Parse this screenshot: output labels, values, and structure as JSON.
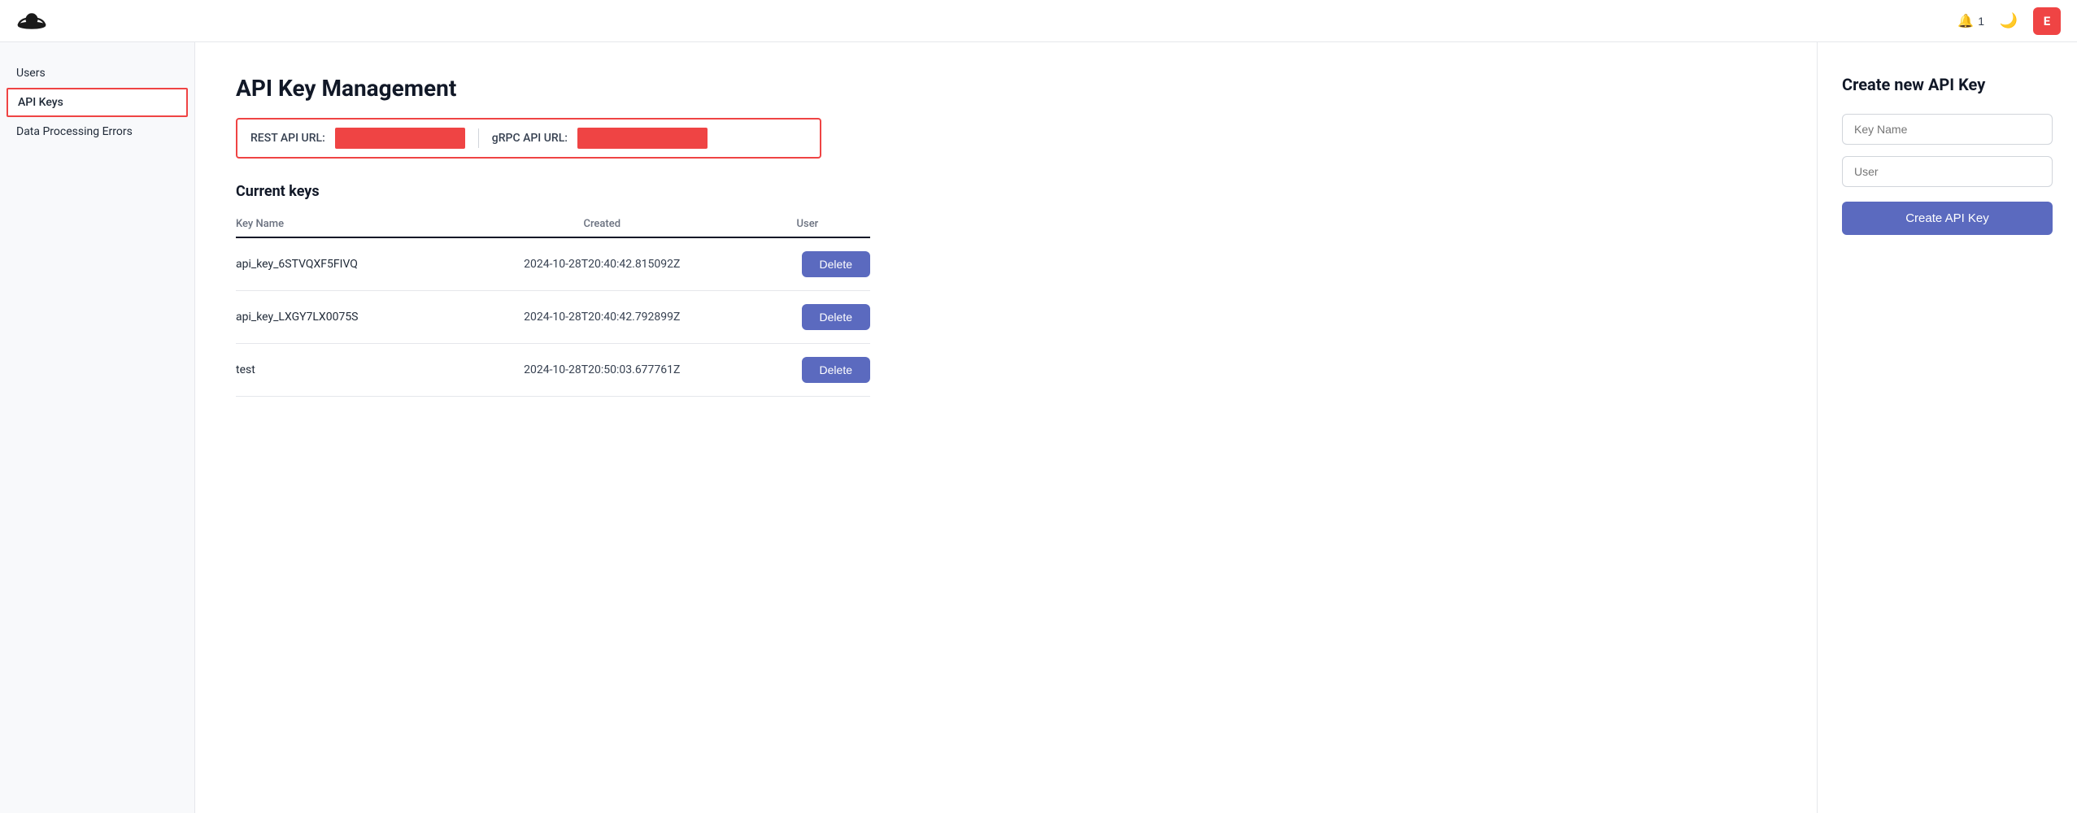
{
  "topnav": {
    "logo_alt": "Logo",
    "notifications": {
      "icon": "🔔",
      "count": "1"
    },
    "theme_icon": "🌙",
    "user_initial": "E"
  },
  "sidebar": {
    "items": [
      {
        "id": "users",
        "label": "Users",
        "active": false
      },
      {
        "id": "api-keys",
        "label": "API Keys",
        "active": true
      },
      {
        "id": "data-processing-errors",
        "label": "Data Processing Errors",
        "active": false
      }
    ]
  },
  "main": {
    "page_title": "API Key Management",
    "api_url_bar": {
      "rest_label": "REST API URL:",
      "grpc_label": "gRPC API URL:"
    },
    "current_keys_title": "Current keys",
    "table": {
      "headers": [
        "Key Name",
        "Created",
        "User"
      ],
      "rows": [
        {
          "key_name": "api_key_6STVQXF5FIVQ",
          "created": "2024-10-28T20:40:42.815092Z",
          "user": ""
        },
        {
          "key_name": "api_key_LXGY7LX0075S",
          "created": "2024-10-28T20:40:42.792899Z",
          "user": ""
        },
        {
          "key_name": "test",
          "created": "2024-10-28T20:50:03.677761Z",
          "user": ""
        }
      ],
      "delete_label": "Delete"
    }
  },
  "right_panel": {
    "title": "Create new API Key",
    "key_name_placeholder": "Key Name",
    "user_placeholder": "User",
    "create_button_label": "Create API Key"
  }
}
